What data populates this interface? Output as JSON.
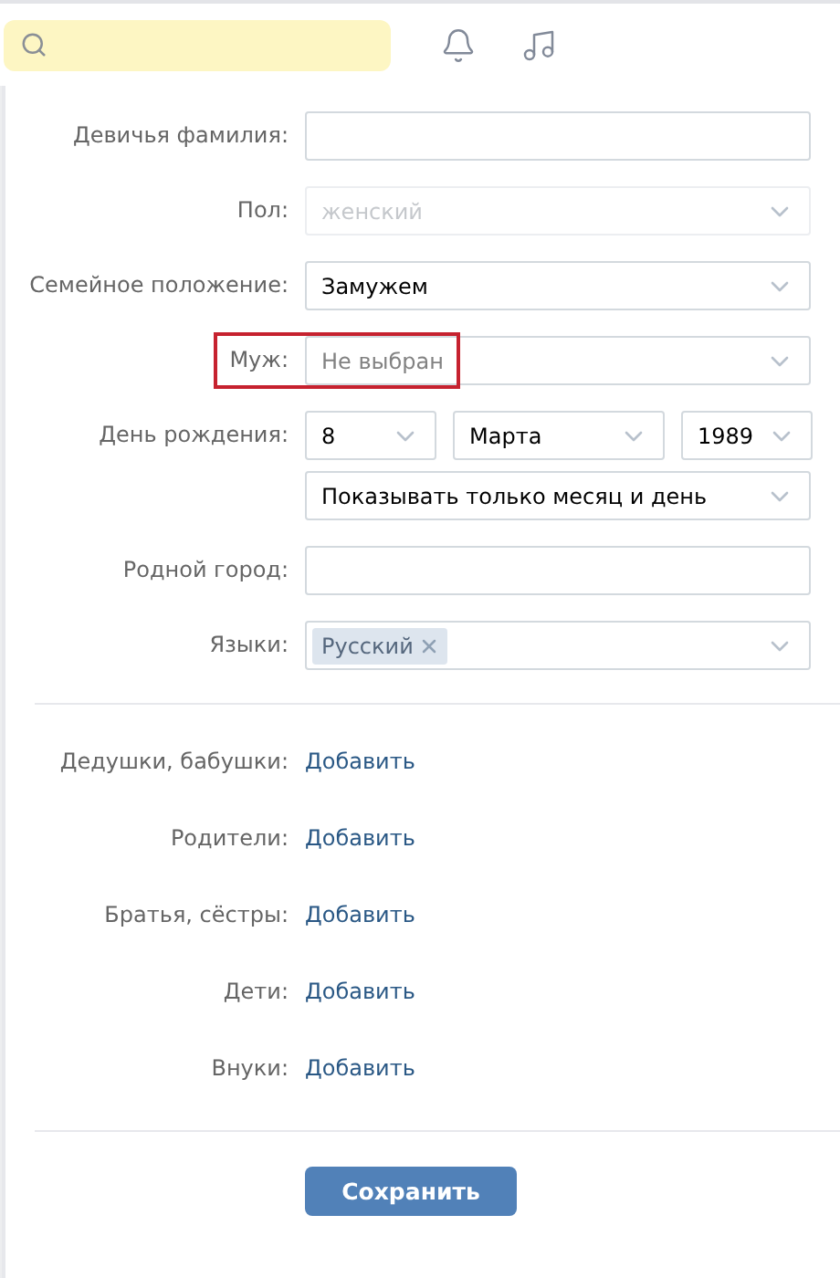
{
  "fields": [
    {
      "kind": "text",
      "label": "Девичья фамилия:"
    },
    {
      "kind": "select",
      "label": "Пол:",
      "value": "женский",
      "disabled": true,
      "highlighted": false
    },
    {
      "kind": "select",
      "label": "Семейное положение:",
      "value": "Замужем",
      "disabled": false,
      "highlighted": false
    },
    {
      "kind": "select",
      "label": "Муж:",
      "placeholder": "Не выбран",
      "disabled": false,
      "highlighted": true
    },
    {
      "kind": "date",
      "label": "День рождения:",
      "selects": [
        "8",
        "Марта",
        "1989"
      ],
      "visibility": "Показывать только месяц и день"
    },
    {
      "kind": "text",
      "label": "Родной город:"
    },
    {
      "kind": "tags",
      "label": "Языки:",
      "tags": [
        "Русский"
      ]
    }
  ],
  "relatives": [
    {
      "label": "Дедушки, бабушки:",
      "link": "Добавить"
    },
    {
      "label": "Родители:",
      "link": "Добавить"
    },
    {
      "label": "Братья, сёстры:",
      "link": "Добавить"
    },
    {
      "label": "Дети:",
      "link": "Добавить"
    },
    {
      "label": "Внуки:",
      "link": "Добавить"
    }
  ],
  "save_button": "Сохранить"
}
